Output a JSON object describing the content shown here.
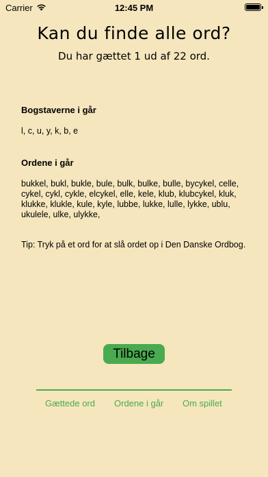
{
  "status_bar": {
    "carrier": "Carrier",
    "time": "12:45 PM"
  },
  "header": {
    "title": "Kan du finde alle ord?",
    "subtitle": "Du har gættet 1 ud af 22 ord."
  },
  "letters": {
    "heading": "Bogstaverne i går",
    "text": "l, c, u, y, k, b, e"
  },
  "words": {
    "heading": "Ordene i går",
    "text": "bukkel, bukl, bukle, bule, bulk, bulke, bulle, bycykel, celle, cykel, cykl, cykle, elcykel, elle, kele, klub, klubcykel, kluk, klukke, klukle, kule, kyle, lubbe, lukke, lulle, lykke, ublu, ukulele, ulke, ulykke,"
  },
  "tip": "Tip: Tryk på et ord for at slå ordet op i Den Danske Ordbog.",
  "back_button": "Tilbage",
  "tabs": {
    "guessed": "Gættede ord",
    "yesterday": "Ordene i går",
    "about": "Om spillet"
  },
  "colors": {
    "background": "#f5e6bd",
    "accent": "#4aaa50"
  }
}
